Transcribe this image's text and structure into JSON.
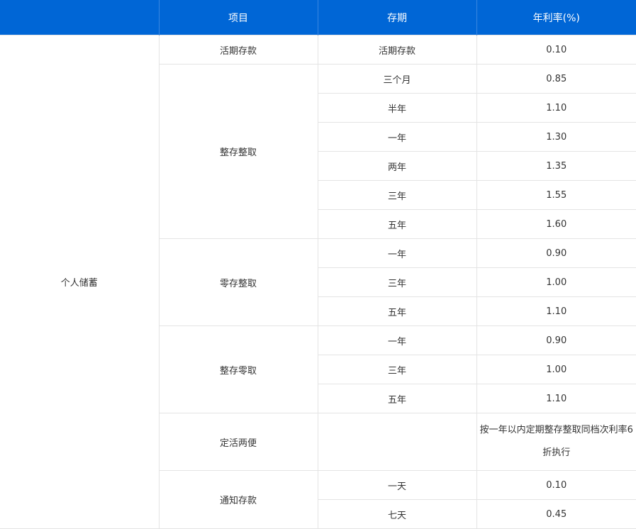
{
  "header": {
    "col1": "",
    "col2": "项目",
    "col3": "存期",
    "col4": "年利率(%)"
  },
  "category": "个人储蓄",
  "items": [
    {
      "name": "活期存款",
      "rows": [
        {
          "term": "活期存款",
          "rate": "0.10"
        }
      ]
    },
    {
      "name": "整存整取",
      "rows": [
        {
          "term": "三个月",
          "rate": "0.85"
        },
        {
          "term": "半年",
          "rate": "1.10"
        },
        {
          "term": "一年",
          "rate": "1.30"
        },
        {
          "term": "两年",
          "rate": "1.35"
        },
        {
          "term": "三年",
          "rate": "1.55"
        },
        {
          "term": "五年",
          "rate": "1.60"
        }
      ]
    },
    {
      "name": "零存整取",
      "rows": [
        {
          "term": "一年",
          "rate": "0.90"
        },
        {
          "term": "三年",
          "rate": "1.00"
        },
        {
          "term": "五年",
          "rate": "1.10"
        }
      ]
    },
    {
      "name": "整存零取",
      "rows": [
        {
          "term": "一年",
          "rate": "0.90"
        },
        {
          "term": "三年",
          "rate": "1.00"
        },
        {
          "term": "五年",
          "rate": "1.10"
        }
      ]
    },
    {
      "name": "定活两便",
      "rows": [
        {
          "term": "",
          "rate": "按一年以内定期整存整取同档次利率6折执行"
        }
      ]
    },
    {
      "name": "通知存款",
      "rows": [
        {
          "term": "一天",
          "rate": "0.10"
        },
        {
          "term": "七天",
          "rate": "0.45"
        }
      ]
    }
  ]
}
